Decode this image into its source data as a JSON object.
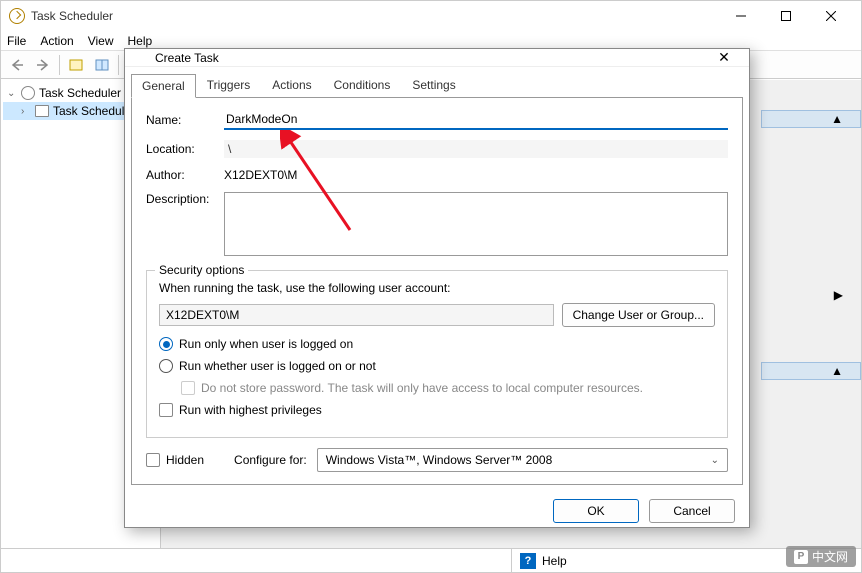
{
  "window": {
    "title": "Task Scheduler",
    "menus": [
      "File",
      "Action",
      "View",
      "Help"
    ]
  },
  "tree": {
    "root": "Task Scheduler (L",
    "child": "Task Schedule"
  },
  "right_accents": {
    "chevrons": [
      "▲",
      "▶",
      "▲"
    ]
  },
  "status": {
    "help": "Help"
  },
  "dialog": {
    "title": "Create Task",
    "tabs": [
      "General",
      "Triggers",
      "Actions",
      "Conditions",
      "Settings"
    ],
    "name_label": "Name:",
    "name_value": "DarkModeOn",
    "location_label": "Location:",
    "location_value": "\\",
    "author_label": "Author:",
    "author_value": "X12DEXT0\\M",
    "description_label": "Description:",
    "security": {
      "legend": "Security options",
      "prompt": "When running the task, use the following user account:",
      "user": "X12DEXT0\\M",
      "change_btn": "Change User or Group...",
      "opt_logged_on": "Run only when user is logged on",
      "opt_any": "Run whether user is logged on or not",
      "opt_nopw": "Do not store password.  The task will only have access to local computer resources.",
      "opt_highest": "Run with highest privileges"
    },
    "hidden_label": "Hidden",
    "configure_label": "Configure for:",
    "configure_value": "Windows Vista™, Windows Server™ 2008",
    "ok": "OK",
    "cancel": "Cancel"
  },
  "watermark": "中文网"
}
